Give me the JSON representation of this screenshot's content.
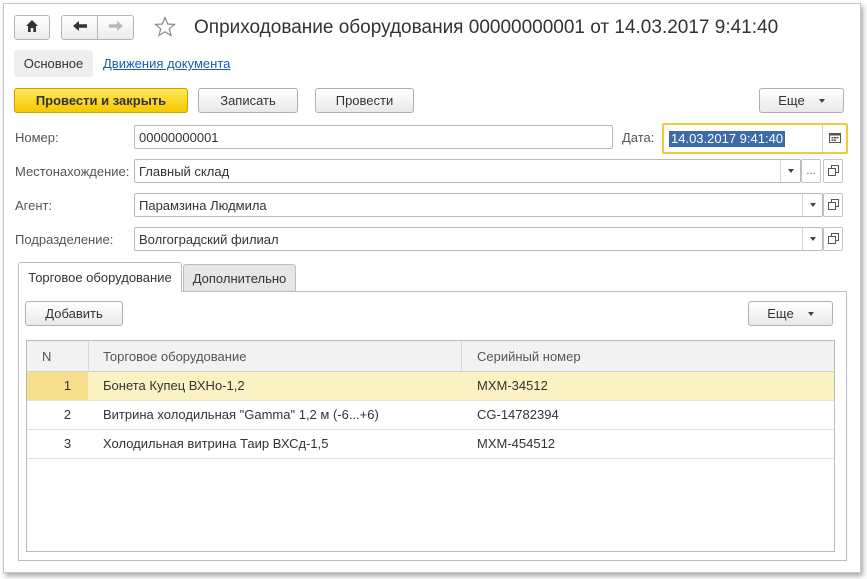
{
  "window": {
    "title": "Оприходование оборудования 00000000001 от 14.03.2017 9:41:40"
  },
  "nav_tabs": {
    "main": "Основное",
    "movements": "Движения документа"
  },
  "toolbar": {
    "post_and_close": "Провести и закрыть",
    "save": "Записать",
    "post": "Провести",
    "more": "Еще"
  },
  "form": {
    "number_label": "Номер:",
    "number_value": "00000000001",
    "date_label": "Дата:",
    "date_value": "14.03.2017  9:41:40",
    "location_label": "Местонахождение:",
    "location_value": "Главный склад",
    "agent_label": "Агент:",
    "agent_value": "Парамзина Людмила",
    "division_label": "Подразделение:",
    "division_value": "Волгоградский филиал",
    "select_dots": "..."
  },
  "tabs": {
    "equipment": "Торговое оборудование",
    "additional": "Дополнительно"
  },
  "table_toolbar": {
    "add": "Добавить",
    "more": "Еще"
  },
  "table": {
    "columns": [
      "N",
      "Торговое оборудование",
      "Серийный номер"
    ],
    "rows": [
      {
        "n": "1",
        "equipment": "Бонета Купец ВХНо-1,2",
        "serial": "MXM-34512"
      },
      {
        "n": "2",
        "equipment": "Витрина холодильная \"Gamma\" 1,2 м (-6...+6)",
        "serial": "CG-14782394"
      },
      {
        "n": "3",
        "equipment": "Холодильная витрина Таир ВХСд-1,5",
        "serial": "MXM-454512"
      }
    ]
  },
  "colors": {
    "primary_button": "#f5c800",
    "link": "#1a5cad",
    "selected_row": "#fbf2c4",
    "date_focus_border": "#f2cb3c",
    "date_selection": "#3d6aa8"
  },
  "icons": [
    "home-icon",
    "back-arrow-icon",
    "forward-arrow-icon",
    "star-icon",
    "calendar-icon",
    "open-icon",
    "chevron-down-icon"
  ]
}
